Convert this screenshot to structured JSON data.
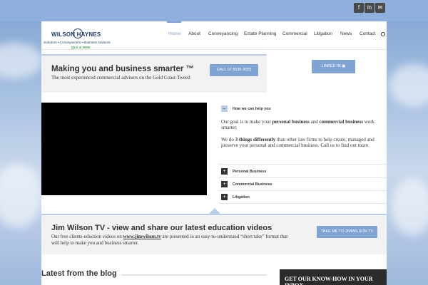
{
  "social": {
    "icons": [
      "facebook-icon",
      "linkedin-icon",
      "email-icon"
    ],
    "glyphs": [
      "f",
      "in",
      "✉"
    ]
  },
  "logo": {
    "name": "WILSON HAYNES",
    "tagline": "Solicitors • Conveyancers • Business Advisors",
    "region": "QLD & NSW"
  },
  "nav": {
    "items": [
      "Home",
      "About",
      "Conveyancing",
      "Estate Planning",
      "Commercial",
      "Litigation",
      "News",
      "Contact"
    ],
    "active": "Home"
  },
  "hero": {
    "title": "Making you and business smarter ™",
    "subtitle": "The most experienced commercial advisers on the Gold Coast-Tweed",
    "call_label": "CALL 07 5536 3055",
    "linkedin_label": "LINKED IN"
  },
  "accordion": {
    "open_title": "How we can help you",
    "p1_prefix": "Our goal is to make your ",
    "p1_bold1": "personal business",
    "p1_mid": " and ",
    "p1_bold2": "commercial business",
    "p1_suffix": " work smarter.",
    "p2_prefix": "We do ",
    "p2_bold": "3 things differently",
    "p2_suffix": " than other law firms to help create, managed and preserve your personal and commercial business. Call us to find out more.",
    "items": [
      "Personal Business",
      "Commercial Business",
      "Litigation"
    ]
  },
  "tv": {
    "title": "Jim Wilson TV - view and share our latest education videos",
    "sub_prefix": "Our free clients-eduction videos on ",
    "sub_link": "www.jimwilson.tv",
    "sub_suffix": " are presented in an easy-to-understand “short take” format that will help to make you and business smarter.",
    "button_label": "TAKE ME TO JIMWILSON.TV"
  },
  "blog": {
    "title": "Latest from the blog"
  },
  "newsletter": {
    "title": "GET OUR KNOW-HOW IN YOUR INBOX"
  },
  "colors": {
    "accent": "#7fa3d2",
    "dark": "#333333",
    "panel": "#f2f2f2"
  }
}
